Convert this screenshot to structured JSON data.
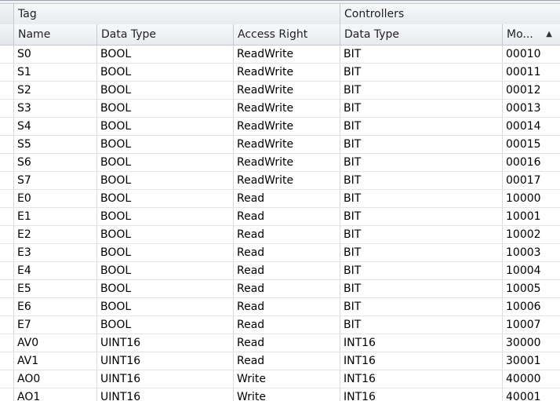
{
  "groups": {
    "tag": "Tag",
    "controllers": "Controllers"
  },
  "columns": {
    "name": "Name",
    "data_type": "Data Type",
    "access_right": "Access Right",
    "controller_data_type": "Data Type",
    "modbus": "Mo...",
    "sort_indicator": "▲"
  },
  "rows": [
    {
      "name": "S0",
      "data_type": "BOOL",
      "access": "ReadWrite",
      "ctype": "BIT",
      "mod": "00010"
    },
    {
      "name": "S1",
      "data_type": "BOOL",
      "access": "ReadWrite",
      "ctype": "BIT",
      "mod": "00011"
    },
    {
      "name": "S2",
      "data_type": "BOOL",
      "access": "ReadWrite",
      "ctype": "BIT",
      "mod": "00012"
    },
    {
      "name": "S3",
      "data_type": "BOOL",
      "access": "ReadWrite",
      "ctype": "BIT",
      "mod": "00013"
    },
    {
      "name": "S4",
      "data_type": "BOOL",
      "access": "ReadWrite",
      "ctype": "BIT",
      "mod": "00014"
    },
    {
      "name": "S5",
      "data_type": "BOOL",
      "access": "ReadWrite",
      "ctype": "BIT",
      "mod": "00015"
    },
    {
      "name": "S6",
      "data_type": "BOOL",
      "access": "ReadWrite",
      "ctype": "BIT",
      "mod": "00016"
    },
    {
      "name": "S7",
      "data_type": "BOOL",
      "access": "ReadWrite",
      "ctype": "BIT",
      "mod": "00017"
    },
    {
      "name": "E0",
      "data_type": "BOOL",
      "access": "Read",
      "ctype": "BIT",
      "mod": "10000"
    },
    {
      "name": "E1",
      "data_type": "BOOL",
      "access": "Read",
      "ctype": "BIT",
      "mod": "10001"
    },
    {
      "name": "E2",
      "data_type": "BOOL",
      "access": "Read",
      "ctype": "BIT",
      "mod": "10002"
    },
    {
      "name": "E3",
      "data_type": "BOOL",
      "access": "Read",
      "ctype": "BIT",
      "mod": "10003"
    },
    {
      "name": "E4",
      "data_type": "BOOL",
      "access": "Read",
      "ctype": "BIT",
      "mod": "10004"
    },
    {
      "name": "E5",
      "data_type": "BOOL",
      "access": "Read",
      "ctype": "BIT",
      "mod": "10005"
    },
    {
      "name": "E6",
      "data_type": "BOOL",
      "access": "Read",
      "ctype": "BIT",
      "mod": "10006"
    },
    {
      "name": "E7",
      "data_type": "BOOL",
      "access": "Read",
      "ctype": "BIT",
      "mod": "10007"
    },
    {
      "name": "AV0",
      "data_type": "UINT16",
      "access": "Read",
      "ctype": "INT16",
      "mod": "30000"
    },
    {
      "name": "AV1",
      "data_type": "UINT16",
      "access": "Read",
      "ctype": "INT16",
      "mod": "30001"
    },
    {
      "name": "AO0",
      "data_type": "UINT16",
      "access": "Write",
      "ctype": "INT16",
      "mod": "40000"
    },
    {
      "name": "AO1",
      "data_type": "UINT16",
      "access": "Write",
      "ctype": "INT16",
      "mod": "40001"
    }
  ]
}
